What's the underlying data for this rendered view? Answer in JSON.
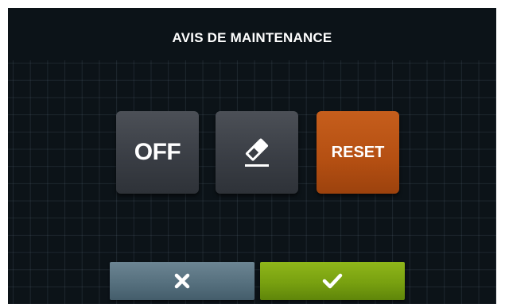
{
  "header": {
    "title": "AVIS DE MAINTENANCE"
  },
  "tiles": {
    "off_label": "OFF",
    "edit_icon": "eraser-icon",
    "reset_label": "RESET"
  },
  "footer": {
    "cancel_icon": "close-icon",
    "confirm_icon": "checkmark-icon"
  },
  "colors": {
    "background": "#0c1318",
    "tile_dark": "#3a3e45",
    "tile_accent": "#b44f12",
    "cancel": "#56707e",
    "confirm": "#78a010"
  }
}
